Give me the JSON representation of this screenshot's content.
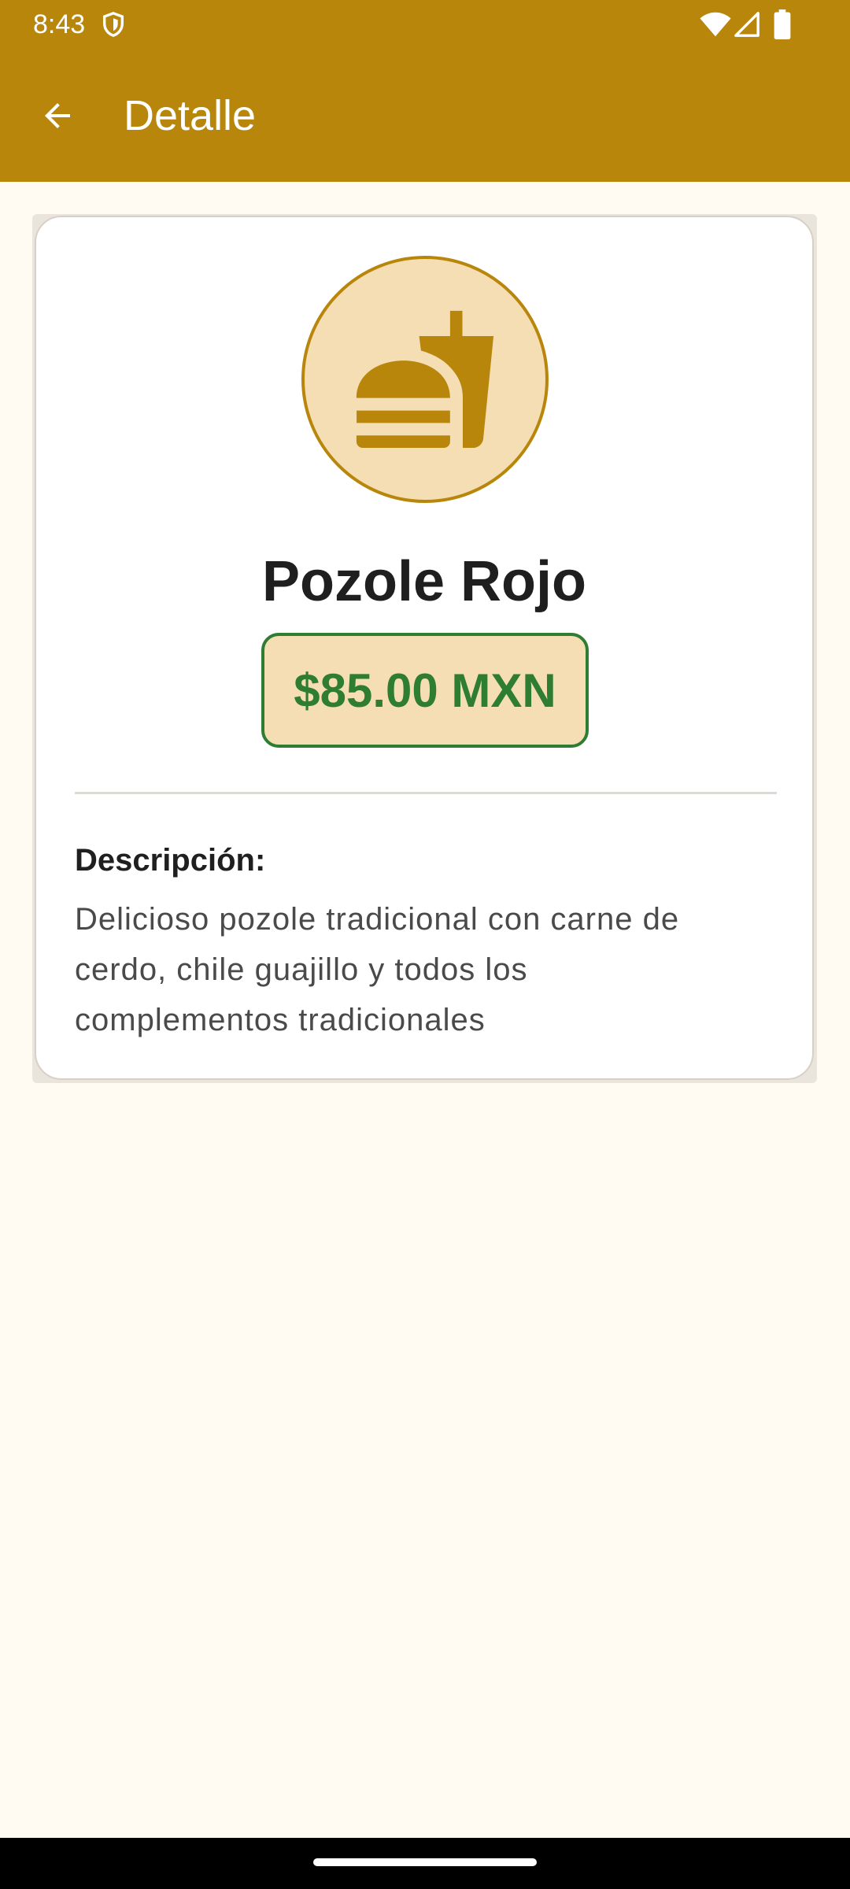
{
  "status_bar": {
    "time": "8:43",
    "icons": [
      "shield-icon",
      "wifi-icon",
      "cell-signal-icon",
      "battery-icon"
    ]
  },
  "app_bar": {
    "back_icon": "arrow-back-icon",
    "title": "Detalle"
  },
  "product": {
    "icon": "fastfood-icon",
    "name": "Pozole Rojo",
    "price": "$85.00 MXN",
    "description_label": "Descripción:",
    "description": "Delicioso pozole tradicional con carne de cerdo, chile guajillo y todos los complementos tradicionales"
  },
  "colors": {
    "primary": "#B8860B",
    "background": "#FFFAF2",
    "accent_light": "#F5DEB3",
    "price_green": "#2E7D32",
    "title_text": "#1F1F1F",
    "body_text": "#4A4A4A"
  }
}
